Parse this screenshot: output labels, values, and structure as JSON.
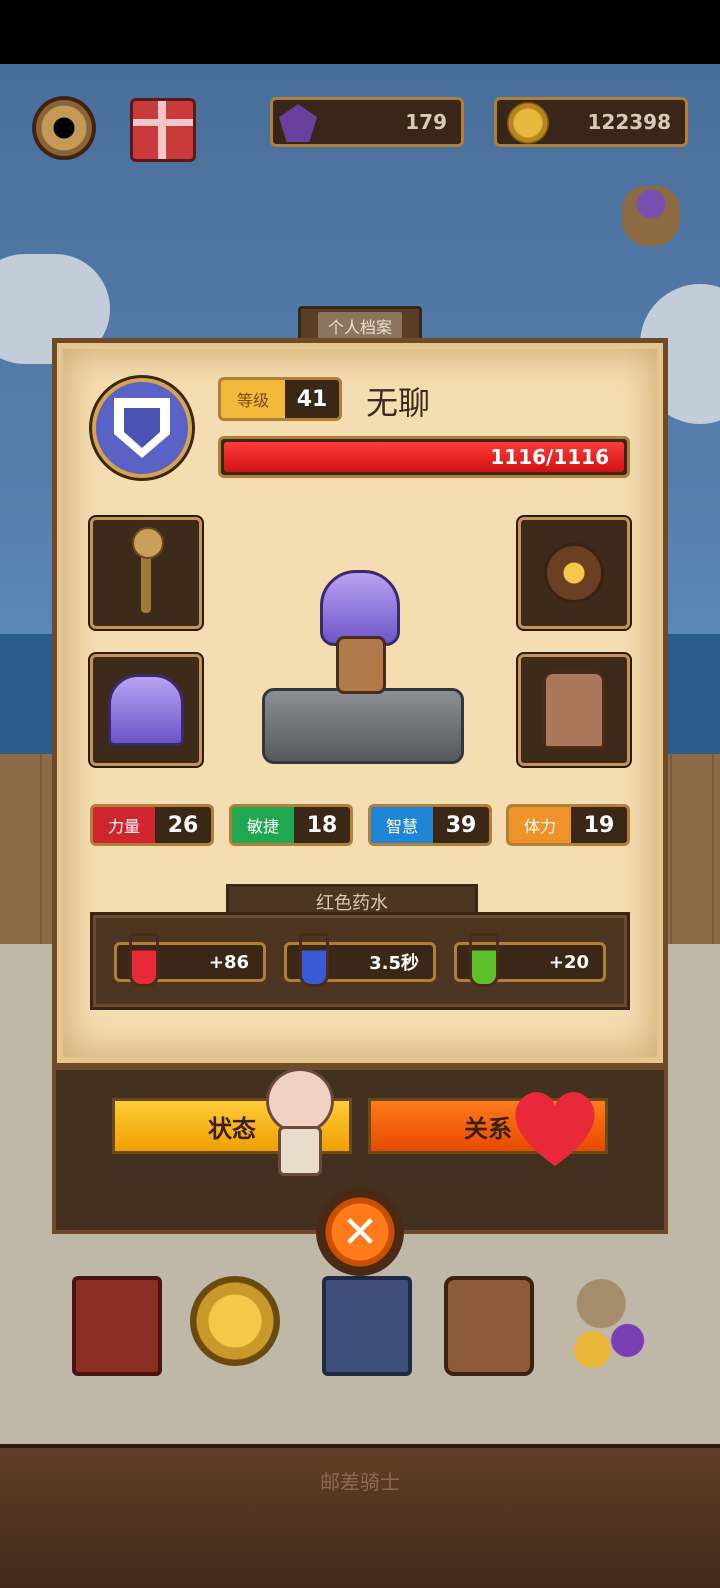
{
  "top_bar": {
    "gems": "179",
    "gold": "122398"
  },
  "profile_tab": "个人档案",
  "player": {
    "level_label": "等级",
    "level": "41",
    "name": "无聊",
    "hp_text": "1116/1116",
    "hp_fraction": 1.0
  },
  "stats": [
    {
      "label": "力量",
      "value": "26",
      "color": "#d0252f"
    },
    {
      "label": "敏捷",
      "value": "18",
      "color": "#1fa850"
    },
    {
      "label": "智慧",
      "value": "39",
      "color": "#1f86d6"
    },
    {
      "label": "体力",
      "value": "19",
      "color": "#f0922a"
    }
  ],
  "potion": {
    "title": "红色药水",
    "effects": [
      {
        "value": "+86",
        "icon": "red-heart-potion-icon",
        "color": "#e8293a"
      },
      {
        "value": "3.5秒",
        "icon": "blue-hourglass-potion-icon",
        "color": "#3a5ad6"
      },
      {
        "value": "+20",
        "icon": "green-armor-potion-icon",
        "color": "#5bbf2a"
      }
    ]
  },
  "buttons": {
    "status": "状态",
    "relation": "关系"
  },
  "footer_title": "邮差骑士"
}
